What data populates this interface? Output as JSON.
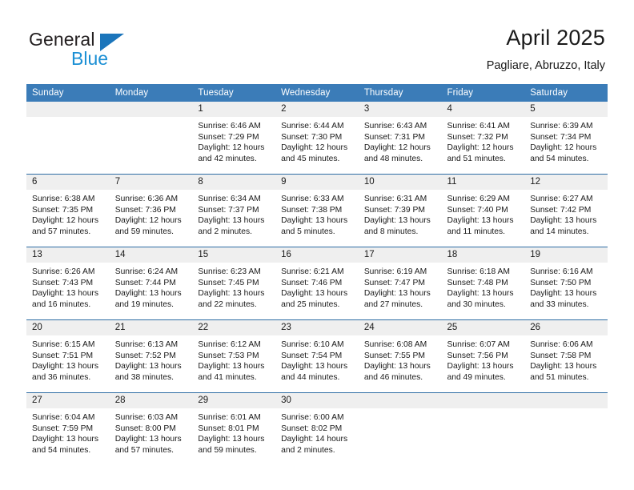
{
  "brand": {
    "name_part1": "General",
    "name_part2": "Blue",
    "triangle_color": "#1b75bb",
    "blue_color": "#1b8fd4"
  },
  "header": {
    "title": "April 2025",
    "subtitle": "Pagliare, Abruzzo, Italy"
  },
  "theme": {
    "header_blue": "#3b7cb8",
    "row_divider_blue": "#2e6da4",
    "daynum_band_gray": "#efefef"
  },
  "weekday_headers": [
    "Sunday",
    "Monday",
    "Tuesday",
    "Wednesday",
    "Thursday",
    "Friday",
    "Saturday"
  ],
  "weeks": [
    [
      {
        "day": "",
        "empty": true,
        "sunrise": "",
        "sunset": "",
        "daylight_line1": "",
        "daylight_line2": ""
      },
      {
        "day": "",
        "empty": true,
        "sunrise": "",
        "sunset": "",
        "daylight_line1": "",
        "daylight_line2": ""
      },
      {
        "day": "1",
        "empty": false,
        "sunrise": "Sunrise: 6:46 AM",
        "sunset": "Sunset: 7:29 PM",
        "daylight_line1": "Daylight: 12 hours",
        "daylight_line2": "and 42 minutes."
      },
      {
        "day": "2",
        "empty": false,
        "sunrise": "Sunrise: 6:44 AM",
        "sunset": "Sunset: 7:30 PM",
        "daylight_line1": "Daylight: 12 hours",
        "daylight_line2": "and 45 minutes."
      },
      {
        "day": "3",
        "empty": false,
        "sunrise": "Sunrise: 6:43 AM",
        "sunset": "Sunset: 7:31 PM",
        "daylight_line1": "Daylight: 12 hours",
        "daylight_line2": "and 48 minutes."
      },
      {
        "day": "4",
        "empty": false,
        "sunrise": "Sunrise: 6:41 AM",
        "sunset": "Sunset: 7:32 PM",
        "daylight_line1": "Daylight: 12 hours",
        "daylight_line2": "and 51 minutes."
      },
      {
        "day": "5",
        "empty": false,
        "sunrise": "Sunrise: 6:39 AM",
        "sunset": "Sunset: 7:34 PM",
        "daylight_line1": "Daylight: 12 hours",
        "daylight_line2": "and 54 minutes."
      }
    ],
    [
      {
        "day": "6",
        "empty": false,
        "sunrise": "Sunrise: 6:38 AM",
        "sunset": "Sunset: 7:35 PM",
        "daylight_line1": "Daylight: 12 hours",
        "daylight_line2": "and 57 minutes."
      },
      {
        "day": "7",
        "empty": false,
        "sunrise": "Sunrise: 6:36 AM",
        "sunset": "Sunset: 7:36 PM",
        "daylight_line1": "Daylight: 12 hours",
        "daylight_line2": "and 59 minutes."
      },
      {
        "day": "8",
        "empty": false,
        "sunrise": "Sunrise: 6:34 AM",
        "sunset": "Sunset: 7:37 PM",
        "daylight_line1": "Daylight: 13 hours",
        "daylight_line2": "and 2 minutes."
      },
      {
        "day": "9",
        "empty": false,
        "sunrise": "Sunrise: 6:33 AM",
        "sunset": "Sunset: 7:38 PM",
        "daylight_line1": "Daylight: 13 hours",
        "daylight_line2": "and 5 minutes."
      },
      {
        "day": "10",
        "empty": false,
        "sunrise": "Sunrise: 6:31 AM",
        "sunset": "Sunset: 7:39 PM",
        "daylight_line1": "Daylight: 13 hours",
        "daylight_line2": "and 8 minutes."
      },
      {
        "day": "11",
        "empty": false,
        "sunrise": "Sunrise: 6:29 AM",
        "sunset": "Sunset: 7:40 PM",
        "daylight_line1": "Daylight: 13 hours",
        "daylight_line2": "and 11 minutes."
      },
      {
        "day": "12",
        "empty": false,
        "sunrise": "Sunrise: 6:27 AM",
        "sunset": "Sunset: 7:42 PM",
        "daylight_line1": "Daylight: 13 hours",
        "daylight_line2": "and 14 minutes."
      }
    ],
    [
      {
        "day": "13",
        "empty": false,
        "sunrise": "Sunrise: 6:26 AM",
        "sunset": "Sunset: 7:43 PM",
        "daylight_line1": "Daylight: 13 hours",
        "daylight_line2": "and 16 minutes."
      },
      {
        "day": "14",
        "empty": false,
        "sunrise": "Sunrise: 6:24 AM",
        "sunset": "Sunset: 7:44 PM",
        "daylight_line1": "Daylight: 13 hours",
        "daylight_line2": "and 19 minutes."
      },
      {
        "day": "15",
        "empty": false,
        "sunrise": "Sunrise: 6:23 AM",
        "sunset": "Sunset: 7:45 PM",
        "daylight_line1": "Daylight: 13 hours",
        "daylight_line2": "and 22 minutes."
      },
      {
        "day": "16",
        "empty": false,
        "sunrise": "Sunrise: 6:21 AM",
        "sunset": "Sunset: 7:46 PM",
        "daylight_line1": "Daylight: 13 hours",
        "daylight_line2": "and 25 minutes."
      },
      {
        "day": "17",
        "empty": false,
        "sunrise": "Sunrise: 6:19 AM",
        "sunset": "Sunset: 7:47 PM",
        "daylight_line1": "Daylight: 13 hours",
        "daylight_line2": "and 27 minutes."
      },
      {
        "day": "18",
        "empty": false,
        "sunrise": "Sunrise: 6:18 AM",
        "sunset": "Sunset: 7:48 PM",
        "daylight_line1": "Daylight: 13 hours",
        "daylight_line2": "and 30 minutes."
      },
      {
        "day": "19",
        "empty": false,
        "sunrise": "Sunrise: 6:16 AM",
        "sunset": "Sunset: 7:50 PM",
        "daylight_line1": "Daylight: 13 hours",
        "daylight_line2": "and 33 minutes."
      }
    ],
    [
      {
        "day": "20",
        "empty": false,
        "sunrise": "Sunrise: 6:15 AM",
        "sunset": "Sunset: 7:51 PM",
        "daylight_line1": "Daylight: 13 hours",
        "daylight_line2": "and 36 minutes."
      },
      {
        "day": "21",
        "empty": false,
        "sunrise": "Sunrise: 6:13 AM",
        "sunset": "Sunset: 7:52 PM",
        "daylight_line1": "Daylight: 13 hours",
        "daylight_line2": "and 38 minutes."
      },
      {
        "day": "22",
        "empty": false,
        "sunrise": "Sunrise: 6:12 AM",
        "sunset": "Sunset: 7:53 PM",
        "daylight_line1": "Daylight: 13 hours",
        "daylight_line2": "and 41 minutes."
      },
      {
        "day": "23",
        "empty": false,
        "sunrise": "Sunrise: 6:10 AM",
        "sunset": "Sunset: 7:54 PM",
        "daylight_line1": "Daylight: 13 hours",
        "daylight_line2": "and 44 minutes."
      },
      {
        "day": "24",
        "empty": false,
        "sunrise": "Sunrise: 6:08 AM",
        "sunset": "Sunset: 7:55 PM",
        "daylight_line1": "Daylight: 13 hours",
        "daylight_line2": "and 46 minutes."
      },
      {
        "day": "25",
        "empty": false,
        "sunrise": "Sunrise: 6:07 AM",
        "sunset": "Sunset: 7:56 PM",
        "daylight_line1": "Daylight: 13 hours",
        "daylight_line2": "and 49 minutes."
      },
      {
        "day": "26",
        "empty": false,
        "sunrise": "Sunrise: 6:06 AM",
        "sunset": "Sunset: 7:58 PM",
        "daylight_line1": "Daylight: 13 hours",
        "daylight_line2": "and 51 minutes."
      }
    ],
    [
      {
        "day": "27",
        "empty": false,
        "sunrise": "Sunrise: 6:04 AM",
        "sunset": "Sunset: 7:59 PM",
        "daylight_line1": "Daylight: 13 hours",
        "daylight_line2": "and 54 minutes."
      },
      {
        "day": "28",
        "empty": false,
        "sunrise": "Sunrise: 6:03 AM",
        "sunset": "Sunset: 8:00 PM",
        "daylight_line1": "Daylight: 13 hours",
        "daylight_line2": "and 57 minutes."
      },
      {
        "day": "29",
        "empty": false,
        "sunrise": "Sunrise: 6:01 AM",
        "sunset": "Sunset: 8:01 PM",
        "daylight_line1": "Daylight: 13 hours",
        "daylight_line2": "and 59 minutes."
      },
      {
        "day": "30",
        "empty": false,
        "sunrise": "Sunrise: 6:00 AM",
        "sunset": "Sunset: 8:02 PM",
        "daylight_line1": "Daylight: 14 hours",
        "daylight_line2": "and 2 minutes."
      },
      {
        "day": "",
        "empty": true,
        "sunrise": "",
        "sunset": "",
        "daylight_line1": "",
        "daylight_line2": ""
      },
      {
        "day": "",
        "empty": true,
        "sunrise": "",
        "sunset": "",
        "daylight_line1": "",
        "daylight_line2": ""
      },
      {
        "day": "",
        "empty": true,
        "sunrise": "",
        "sunset": "",
        "daylight_line1": "",
        "daylight_line2": ""
      }
    ]
  ]
}
